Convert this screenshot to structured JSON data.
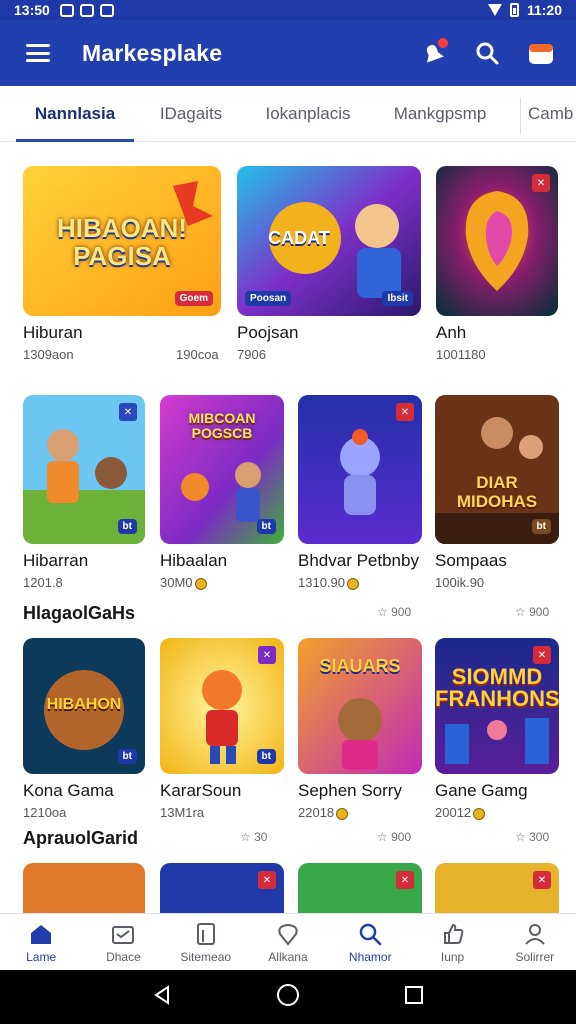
{
  "status_bar": {
    "time": "13:50",
    "right_text": "11:20"
  },
  "app_bar": {
    "title": "Markesplake"
  },
  "tabs": [
    "Nannlasia",
    "IDagaits",
    "Iokanplacis",
    "Mankgpsmp",
    "Camb"
  ],
  "row1": [
    {
      "title": "Hiburan",
      "sub": "1309aon",
      "extra": "190coa",
      "art_text": "HIBAOAN! PAGISA",
      "badge": "Goem"
    },
    {
      "title": "Poojsan",
      "sub": "7906",
      "art_text": "CADAT",
      "badge": "Poosan",
      "badge2": "Ibsit"
    },
    {
      "title": "Anh",
      "sub": "1001180"
    }
  ],
  "row2": [
    {
      "title": "Hibarran",
      "sub": "1201.8",
      "badge": "bt"
    },
    {
      "title": "Hibaalan",
      "sub": "30M0",
      "art_text": "MIBCOAN POGSCB",
      "badge": "bt"
    },
    {
      "title": "Bhdvar Petbnby",
      "sub": "1310.90"
    },
    {
      "title": "Sompaas",
      "sub": "100ik.90",
      "art_text": "DIAR MIDOHAS",
      "badge": "bt"
    }
  ],
  "section1": {
    "title": "HlagaolGaHs",
    "ratings": [
      "900",
      "900"
    ]
  },
  "row3": [
    {
      "title": "Kona Gama",
      "sub": "1210oa",
      "art_text": "HIBAHON",
      "badge": "bt"
    },
    {
      "title": "KararSoun",
      "sub": "13M1ra",
      "badge": "bt"
    },
    {
      "title": "Sephen Sorry",
      "sub": "22018",
      "art_text": "SIAUARS"
    },
    {
      "title": "Gane Gamg",
      "sub": "20012",
      "art_text": "SIOMMD FRANHONS"
    }
  ],
  "section2": {
    "title": "AprauolGarid",
    "ratings": [
      "30",
      "900",
      "300"
    ]
  },
  "bottom_nav": [
    {
      "label": "Lame",
      "icon": "home-icon"
    },
    {
      "label": "Dhace",
      "icon": "cart-icon"
    },
    {
      "label": "Sitemeao",
      "icon": "store-icon"
    },
    {
      "label": "Allkana",
      "icon": "pin-icon"
    },
    {
      "label": "Nhamor",
      "icon": "search-icon"
    },
    {
      "label": "Iunp",
      "icon": "thumb-icon"
    },
    {
      "label": "Solirrer",
      "icon": "person-icon"
    }
  ],
  "colors": {
    "primary": "#213fae",
    "accent_red": "#d52c3a"
  }
}
